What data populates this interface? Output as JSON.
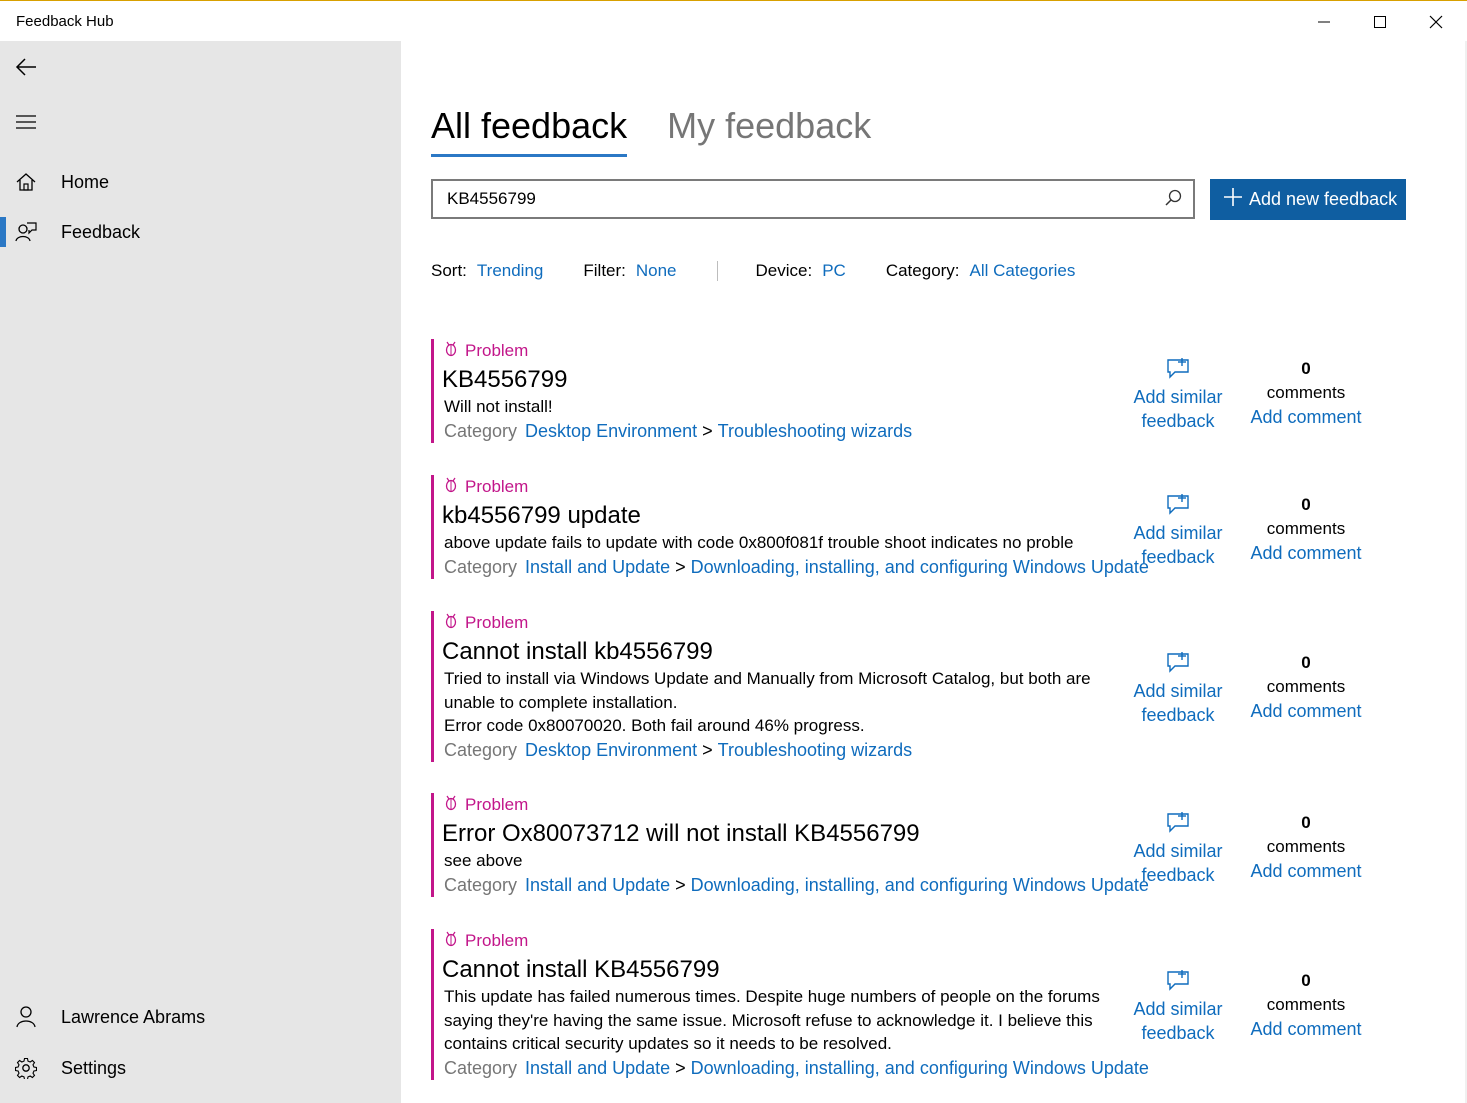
{
  "window": {
    "title": "Feedback Hub"
  },
  "sidebar": {
    "items": [
      {
        "label": "Home",
        "icon": "home-icon"
      },
      {
        "label": "Feedback",
        "icon": "feedback-icon",
        "selected": true
      }
    ],
    "bottom": [
      {
        "label": "Lawrence Abrams",
        "icon": "person-icon"
      },
      {
        "label": "Settings",
        "icon": "gear-icon"
      }
    ]
  },
  "tabs": [
    {
      "label": "All feedback",
      "active": true
    },
    {
      "label": "My feedback",
      "active": false
    }
  ],
  "search": {
    "value": "KB4556799"
  },
  "add_button": {
    "label": "Add new feedback"
  },
  "filters": {
    "sort": {
      "key": "Sort:",
      "value": "Trending"
    },
    "filter": {
      "key": "Filter:",
      "value": "None"
    },
    "device": {
      "key": "Device:",
      "value": "PC"
    },
    "category": {
      "key": "Category:",
      "value": "All Categories"
    }
  },
  "feedback_items": [
    {
      "kind": "Problem",
      "title": "KB4556799",
      "description": "Will not install!",
      "category_label": "Category",
      "category": "Desktop Environment",
      "subcategory": "Troubleshooting wizards",
      "similar_label": "Add similar feedback",
      "comment_count": "0",
      "comments_word": "comments",
      "add_comment": "Add comment"
    },
    {
      "kind": "Problem",
      "title": "kb4556799 update",
      "description": "above update fails to update with code 0x800f081f trouble shoot indicates no proble",
      "category_label": "Category",
      "category": "Install and Update",
      "subcategory": "Downloading, installing, and configuring Windows Update",
      "similar_label": "Add similar feedback",
      "comment_count": "0",
      "comments_word": "comments",
      "add_comment": "Add comment"
    },
    {
      "kind": "Problem",
      "title": "Cannot install kb4556799",
      "description": "Tried to install via Windows Update and Manually from Microsoft Catalog, but both are unable to complete installation.\nError code 0x80070020. Both fail around 46% progress.",
      "category_label": "Category",
      "category": "Desktop Environment",
      "subcategory": "Troubleshooting wizards",
      "similar_label": "Add similar feedback",
      "comment_count": "0",
      "comments_word": "comments",
      "add_comment": "Add comment"
    },
    {
      "kind": "Problem",
      "title": "Error Ox80073712 will not install KB4556799",
      "description": "see above",
      "category_label": "Category",
      "category": "Install and Update",
      "subcategory": "Downloading, installing, and configuring Windows Update",
      "similar_label": "Add similar feedback",
      "comment_count": "0",
      "comments_word": "comments",
      "add_comment": "Add comment"
    },
    {
      "kind": "Problem",
      "title": "Cannot install KB4556799",
      "description": "This update has failed numerous times.  Despite huge numbers of people on the forums saying they're having the same issue. Microsoft refuse to acknowledge it.  I believe this contains critical security updates so it needs to be resolved.",
      "category_label": "Category",
      "category": "Install and Update",
      "subcategory": "Downloading, installing, and configuring Windows Update",
      "similar_label": "Add similar feedback",
      "comment_count": "0",
      "comments_word": "comments",
      "add_comment": "Add comment"
    }
  ],
  "colors": {
    "accent": "#0f6cbd",
    "problem": "#c2168a",
    "sidebar_bg": "#e6e6e6",
    "button_bg": "#0f5ea1"
  }
}
